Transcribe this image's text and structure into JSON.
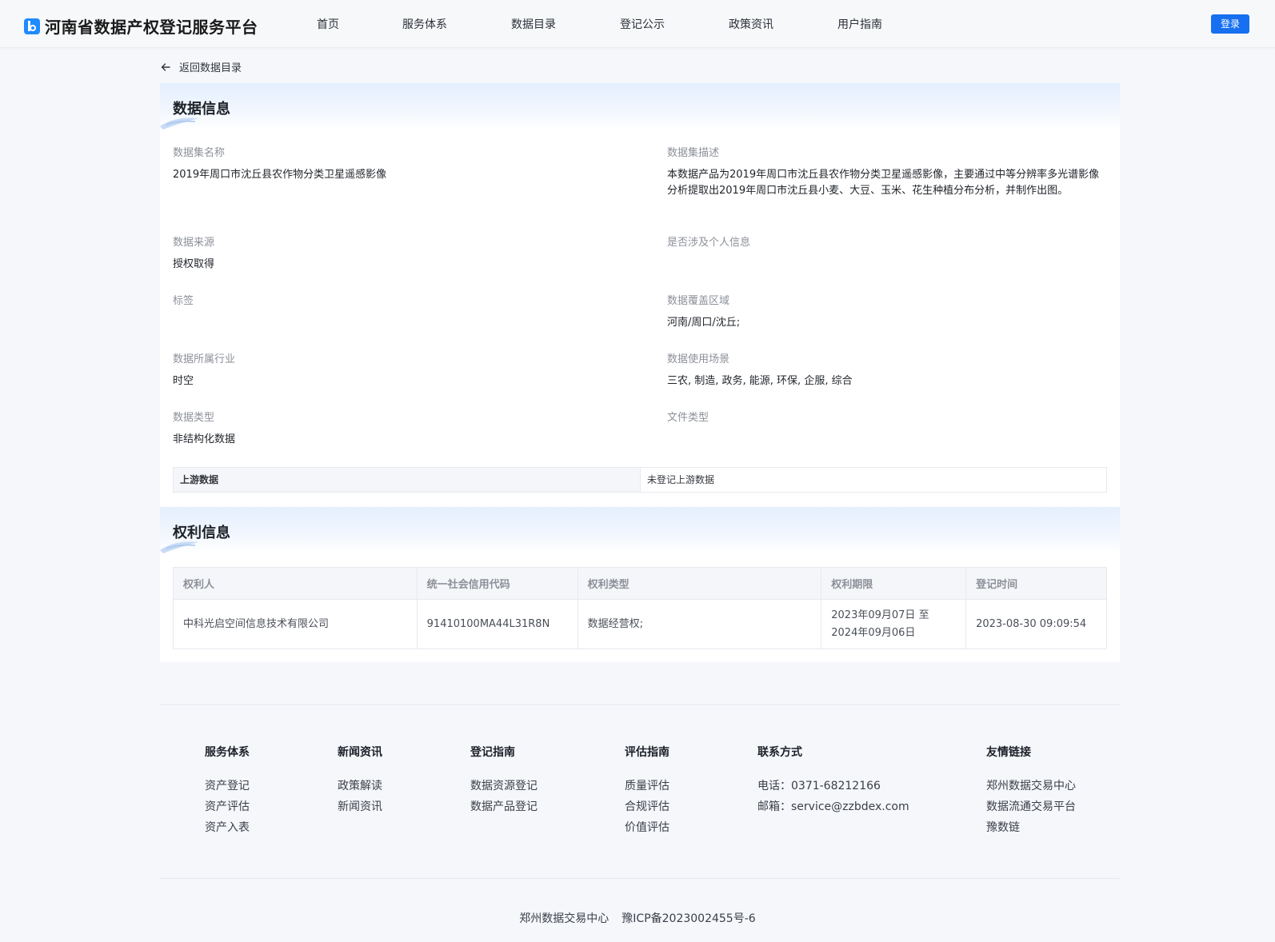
{
  "header": {
    "logo_text": "河南省数据产权登记服务平台",
    "nav": [
      "首页",
      "服务体系",
      "数据目录",
      "登记公示",
      "政策资讯",
      "用户指南"
    ],
    "login_label": "登录",
    "accent_color": "#1670f0"
  },
  "back": {
    "label": "返回数据目录"
  },
  "data_info": {
    "title": "数据信息",
    "fields": {
      "dataset_name": {
        "label": "数据集名称",
        "value": "2019年周口市沈丘县农作物分类卫星遥感影像"
      },
      "description": {
        "label": "数据集描述",
        "value": "本数据产品为2019年周口市沈丘县农作物分类卫星遥感影像，主要通过中等分辨率多光谱影像分析提取出2019年周口市沈丘县小麦、大豆、玉米、花生种植分布分析，并制作出图。"
      },
      "source": {
        "label": "数据来源",
        "value": "授权取得"
      },
      "personal_info": {
        "label": "是否涉及个人信息",
        "value": ""
      },
      "tags": {
        "label": "标签",
        "value": ""
      },
      "coverage": {
        "label": "数据覆盖区域",
        "value": "河南/周口/沈丘;"
      },
      "industry": {
        "label": "数据所属行业",
        "value": "时空"
      },
      "scenarios": {
        "label": "数据使用场景",
        "value": "三农, 制造, 政务, 能源, 环保, 企服, 综合"
      },
      "data_type": {
        "label": "数据类型",
        "value": "非结构化数据"
      },
      "file_type": {
        "label": "文件类型",
        "value": ""
      }
    },
    "upstream": {
      "label": "上游数据",
      "value": "未登记上游数据"
    }
  },
  "rights_info": {
    "title": "权利信息",
    "columns": [
      "权利人",
      "统一社会信用代码",
      "权利类型",
      "权利期限",
      "登记时间"
    ],
    "rows": [
      {
        "holder": "中科光启空间信息技术有限公司",
        "credit_code": "91410100MA44L31R8N",
        "right_type": "数据经营权;",
        "term_line1": "2023年09月07日 至",
        "term_line2": "2024年09月06日",
        "registered_at": "2023-08-30 09:09:54"
      }
    ]
  },
  "footer": {
    "columns": [
      {
        "title": "服务体系",
        "links": [
          "资产登记",
          "资产评估",
          "资产入表"
        ]
      },
      {
        "title": "新闻资讯",
        "links": [
          "政策解读",
          "新闻资讯"
        ]
      },
      {
        "title": "登记指南",
        "links": [
          "数据资源登记",
          "数据产品登记"
        ]
      },
      {
        "title": "评估指南",
        "links": [
          "质量评估",
          "合规评估",
          "价值评估"
        ]
      },
      {
        "title": "联系方式",
        "links": [
          "电话：0371-68212166",
          "邮箱：service@zzbdex.com"
        ]
      },
      {
        "title": "友情链接",
        "links": [
          "郑州数据交易中心",
          "数据流通交易平台",
          "豫数链"
        ]
      }
    ],
    "org": "郑州数据交易中心",
    "icp": "豫ICP备2023002455号-6"
  }
}
